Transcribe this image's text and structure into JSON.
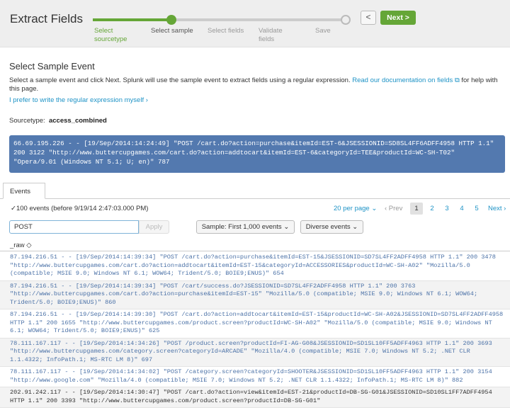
{
  "header": {
    "title": "Extract Fields",
    "steps": [
      "Select sourcetype",
      "Select sample",
      "Select fields",
      "Validate fields",
      "Save"
    ],
    "back_label": "<",
    "next_label": "Next >"
  },
  "section": {
    "title": "Select Sample Event",
    "intro": "Select a sample event and click Next. Splunk will use the sample event to extract fields using a regular expression.",
    "doc_link": "Read our documentation on fields",
    "intro_suffix": "for help with this page.",
    "regex_link": "I prefer to write the regular expression myself",
    "sourcetype_label": "Sourcetype:",
    "sourcetype_value": "access_combined"
  },
  "sample_event": "66.69.195.226 - - [19/Sep/2014:14:24:49] \"POST /cart.do?action=purchase&itemId=EST-6&JSESSIONID=SD8SL4FF6ADFF4958 HTTP 1.1\" 200 3122 \"http://www.buttercupgames.com/cart.do?action=addtocart&itemId=EST-6&categoryId=TEE&productId=WC-SH-T02\" \"Opera/9.01 (Windows NT 5.1; U; en)\" 787",
  "tabs": {
    "events": "Events"
  },
  "events": {
    "count": "✓100 events (before 9/19/14 2:47:03.000 PM)",
    "per_page": "20 per page ⌄",
    "prev": "‹ Prev",
    "pages": [
      "1",
      "2",
      "3",
      "4",
      "5"
    ],
    "next": "Next ›"
  },
  "filter": {
    "value": "POST",
    "apply_label": "Apply",
    "sample_dd": "Sample: First 1,000 events ⌄",
    "diverse_dd": "Diverse events ⌄"
  },
  "raw_header": "_raw ◇",
  "rows": [
    "87.194.216.51 - - [19/Sep/2014:14:39:34] \"POST /cart.do?action=purchase&itemId=EST-15&JSESSIONID=SD7SL4FF2ADFF4958 HTTP 1.1\" 200 3478 \"http://www.buttercupgames.com/cart.do?action=addtocart&itemId=EST-15&categoryId=ACCESSORIES&productId=WC-SH-A02\" \"Mozilla/5.0 (compatible; MSIE 9.0; Windows NT 6.1; WOW64; Trident/5.0; BOIE9;ENUS)\" 654",
    "87.194.216.51 - - [19/Sep/2014:14:39:34] \"POST /cart/success.do?JSESSIONID=SD7SL4FF2ADFF4958 HTTP 1.1\" 200 3763 \"http://www.buttercupgames.com/cart.do?action=purchase&itemId=EST-15\" \"Mozilla/5.0 (compatible; MSIE 9.0; Windows NT 6.1; WOW64; Trident/5.0; BOIE9;ENUS)\" 860",
    "87.194.216.51 - - [19/Sep/2014:14:39:30] \"POST /cart.do?action=addtocart&itemId=EST-15&productId=WC-SH-A02&JSESSIONID=SD7SL4FF2ADFF4958 HTTP 1.1\" 200 1655 \"http://www.buttercupgames.com/product.screen?productId=WC-SH-A02\" \"Mozilla/5.0 (compatible; MSIE 9.0; Windows NT 6.1; WOW64; Trident/5.0; BOIE9;ENUS)\" 625",
    "78.111.167.117 - - [19/Sep/2014:14:34:26] \"POST /product.screen?productId=FI-AG-G08&JSESSIONID=SD1SL10FF5ADFF4963 HTTP 1.1\" 200 3693 \"http://www.buttercupgames.com/category.screen?categoryId=ARCADE\" \"Mozilla/4.0 (compatible; MSIE 7.0; Windows NT 5.2; .NET CLR 1.1.4322; InfoPath.1; MS-RTC LM 8)\" 697",
    "78.111.167.117 - - [19/Sep/2014:14:34:02] \"POST /category.screen?categoryId=SHOOTER&JSESSIONID=SD1SL10FF5ADFF4963 HTTP 1.1\" 200 3154 \"http://www.google.com\" \"Mozilla/4.0 (compatible; MSIE 7.0; Windows NT 5.2; .NET CLR 1.1.4322; InfoPath.1; MS-RTC LM 8)\" 882",
    "202.91.242.117 - - [19/Sep/2014:14:30:47] \"POST /cart.do?action=view&itemId=EST-21&productId=DB-SG-G01&JSESSIONID=SD10SL1FF7ADFF4954 HTTP 1.1\" 200 3393 \"http://www.buttercupgames.com/product.screen?productId=DB-SG-G01\""
  ]
}
